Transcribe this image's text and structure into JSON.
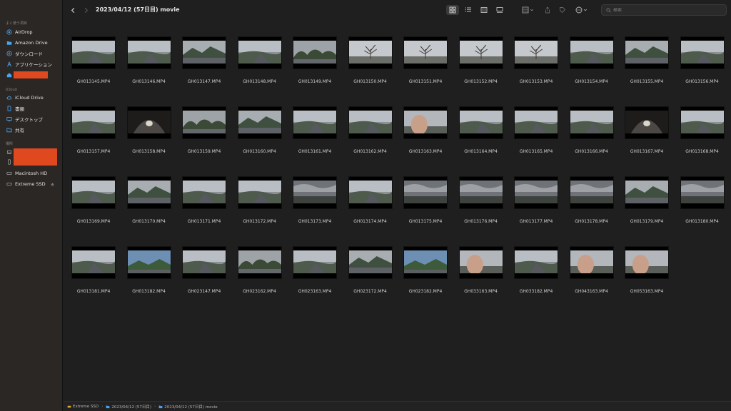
{
  "sidebar": {
    "favorites_label": "よく使う項目",
    "favorites": [
      {
        "label": "AirDrop",
        "icon": "airdrop-icon"
      },
      {
        "label": "Amazon Drive",
        "icon": "folder-icon"
      },
      {
        "label": "ダウンロード",
        "icon": "download-icon"
      },
      {
        "label": "アプリケーション",
        "icon": "applications-icon"
      }
    ],
    "icloud_label": "iCloud",
    "icloud": [
      {
        "label": "iCloud Drive",
        "icon": "icloud-icon"
      },
      {
        "label": "書類",
        "icon": "document-icon"
      },
      {
        "label": "デスクトップ",
        "icon": "desktop-icon"
      },
      {
        "label": "共有",
        "icon": "shared-folder-icon"
      }
    ],
    "locations_label": "場所",
    "locations": [
      {
        "label": "Macintosh HD",
        "icon": "drive-icon"
      },
      {
        "label": "Extreme SSD",
        "icon": "drive-icon"
      }
    ]
  },
  "toolbar": {
    "title": "2023/04/12 (57日目) movie",
    "search_placeholder": "検索"
  },
  "files": [
    {
      "name": "GH013145.MP4",
      "scene": "overcast-road"
    },
    {
      "name": "GH013146.MP4",
      "scene": "overcast-road"
    },
    {
      "name": "GH013147.MP4",
      "scene": "overcast-hills"
    },
    {
      "name": "GH013148.MP4",
      "scene": "overcast-road"
    },
    {
      "name": "GH013149.MP4",
      "scene": "overcast-trees"
    },
    {
      "name": "GH013150.MP4",
      "scene": "bare-tree"
    },
    {
      "name": "GH013151.MP4",
      "scene": "bare-tree"
    },
    {
      "name": "GH013152.MP4",
      "scene": "bare-tree"
    },
    {
      "name": "GH013153.MP4",
      "scene": "bare-tree"
    },
    {
      "name": "GH013154.MP4",
      "scene": "overcast-road"
    },
    {
      "name": "GH013155.MP4",
      "scene": "overcast-hills"
    },
    {
      "name": "GH013156.MP4",
      "scene": "overcast-road"
    },
    {
      "name": "GH013157.MP4",
      "scene": "overcast-road"
    },
    {
      "name": "GH013158.MP4",
      "scene": "tunnel"
    },
    {
      "name": "GH013159.MP4",
      "scene": "overcast-trees"
    },
    {
      "name": "GH013160.MP4",
      "scene": "overcast-hills"
    },
    {
      "name": "GH013161.MP4",
      "scene": "overcast-road"
    },
    {
      "name": "GH013162.MP4",
      "scene": "overcast-road"
    },
    {
      "name": "GH013163.MP4",
      "scene": "hand"
    },
    {
      "name": "GH013164.MP4",
      "scene": "overcast-road"
    },
    {
      "name": "GH013165.MP4",
      "scene": "overcast-road"
    },
    {
      "name": "GH013166.MP4",
      "scene": "overcast-road"
    },
    {
      "name": "GH013167.MP4",
      "scene": "tunnel"
    },
    {
      "name": "GH013168.MP4",
      "scene": "overcast-road"
    },
    {
      "name": "GH013169.MP4",
      "scene": "overcast-road"
    },
    {
      "name": "GH013170.MP4",
      "scene": "overcast-hills"
    },
    {
      "name": "GH013171.MP4",
      "scene": "overcast-road"
    },
    {
      "name": "GH013172.MP4",
      "scene": "overcast-road"
    },
    {
      "name": "GH013173.MP4",
      "scene": "cloudy-sky"
    },
    {
      "name": "GH013174.MP4",
      "scene": "overcast-road"
    },
    {
      "name": "GH013175.MP4",
      "scene": "cloudy-sky"
    },
    {
      "name": "GH013176.MP4",
      "scene": "cloudy-sky"
    },
    {
      "name": "GH013177.MP4",
      "scene": "cloudy-sky"
    },
    {
      "name": "GH013178.MP4",
      "scene": "cloudy-sky"
    },
    {
      "name": "GH013179.MP4",
      "scene": "overcast-hills"
    },
    {
      "name": "GH013180.MP4",
      "scene": "cloudy-sky"
    },
    {
      "name": "GH013181.MP4",
      "scene": "overcast-road"
    },
    {
      "name": "GH013182.MP4",
      "scene": "blue-hills"
    },
    {
      "name": "GH023147.MP4",
      "scene": "overcast-road"
    },
    {
      "name": "GH023162.MP4",
      "scene": "overcast-trees"
    },
    {
      "name": "GH023163.MP4",
      "scene": "overcast-road"
    },
    {
      "name": "GH023172.MP4",
      "scene": "overcast-hills"
    },
    {
      "name": "GH023182.MP4",
      "scene": "blue-hills"
    },
    {
      "name": "GH033163.MP4",
      "scene": "hand"
    },
    {
      "name": "GH033182.MP4",
      "scene": "overcast-road"
    },
    {
      "name": "GH043163.MP4",
      "scene": "hand"
    },
    {
      "name": "GH053163.MP4",
      "scene": "hand"
    }
  ],
  "pathbar": [
    {
      "label": "Extreme SSD",
      "icon": "drive-icon"
    },
    {
      "label": "2023/04/12 (57日目)",
      "icon": "folder-icon"
    },
    {
      "label": "2023/04/12 (57日目) movie",
      "icon": "folder-icon"
    }
  ],
  "colors": {
    "accent": "#0a84ff",
    "redaction": "#e0481f",
    "folder": "#4aa3f0"
  }
}
